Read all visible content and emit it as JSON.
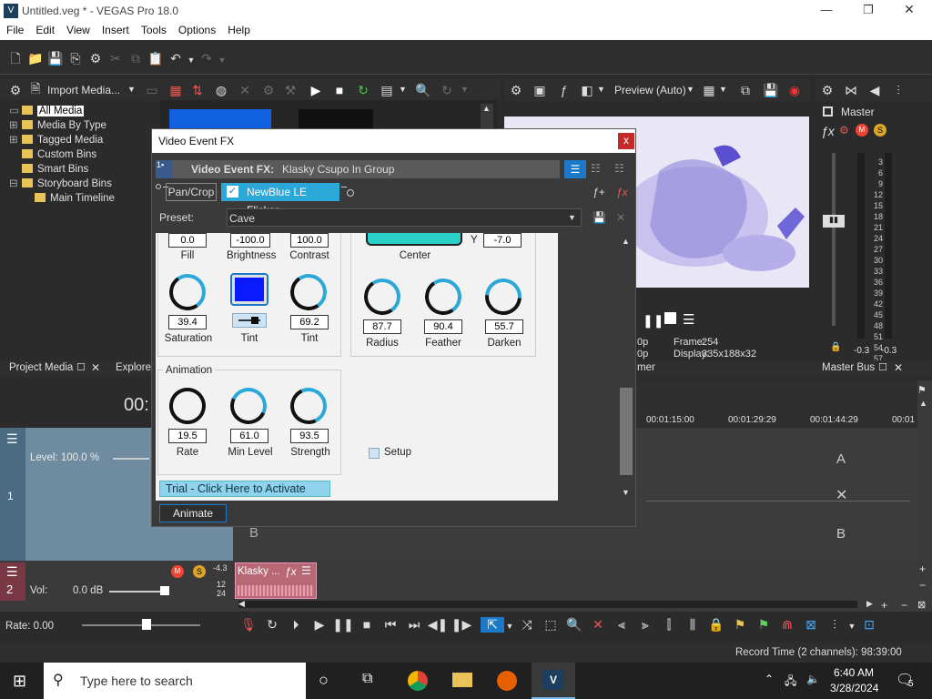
{
  "window": {
    "title": "Untitled.veg * - VEGAS Pro 18.0",
    "icon": "V",
    "minimize": "—",
    "restore": "❐",
    "close": "✕"
  },
  "menu": [
    "File",
    "Edit",
    "View",
    "Insert",
    "Tools",
    "Options",
    "Help"
  ],
  "media_toolbar": {
    "import_label": "Import Media..."
  },
  "tree": {
    "items": [
      "All Media",
      "Media By Type",
      "Tagged Media",
      "Custom Bins",
      "Smart Bins",
      "Storyboard Bins",
      "Main Timeline"
    ]
  },
  "preview": {
    "label": "Preview (Auto)",
    "frame_label": "Frame:",
    "frame_value": "254",
    "display_label": "Display:",
    "display_value": "335x188x32",
    "left_fragment_1": "0p",
    "left_fragment_2": "0p"
  },
  "master": {
    "label": "Master",
    "bus_label": "Master Bus",
    "close": "✕",
    "scale": [
      "3",
      "6",
      "9",
      "12",
      "15",
      "18",
      "21",
      "24",
      "27",
      "30",
      "33",
      "36",
      "39",
      "42",
      "45",
      "48",
      "51",
      "54",
      "57"
    ],
    "peak_left": "-0.3",
    "peak_right": "-0.3"
  },
  "tabs": {
    "project_media": "Project Media",
    "explorer": "Explorer",
    "mixer_fragment": "mer"
  },
  "timecode": "00:",
  "timeline": {
    "ruler": [
      "00:01:15:00",
      "00:01:29:29",
      "00:01:44:29",
      "00:01"
    ],
    "track1": {
      "level": "Level: 100.0 %",
      "number": "1"
    },
    "track2": {
      "number": "2",
      "vol_label": "Vol:",
      "vol_value": "0.0 dB",
      "meter_top": "-4.3",
      "meter_12": "12",
      "meter_24": "24"
    },
    "clip_label": "Klasky ...",
    "transition": {
      "a": "A",
      "b": "B",
      "x": "✕"
    },
    "b_left": "B",
    "rate": "Rate: 0.00"
  },
  "status": {
    "record_time": "Record Time (2 channels): 98:39:00"
  },
  "taskbar": {
    "search_placeholder": "Type here to search",
    "time": "6:40 AM",
    "date": "3/28/2024",
    "notif_count": "5"
  },
  "dialog": {
    "title": "Video Event FX",
    "close": "x",
    "header": "Video Event FX:",
    "header_target": "Klasky Csupo In Group",
    "chain": {
      "pan_crop": "Pan/Crop",
      "effect": "NewBlue LE Flicker"
    },
    "preset_label": "Preset:",
    "preset_value": "Cave",
    "top_values": [
      "0.0",
      "-100.0",
      "100.0"
    ],
    "top_labels": [
      "Fill",
      "Brightness",
      "Contrast"
    ],
    "center_label": "Center",
    "y_label": "Y",
    "y_value": "-7.0",
    "row2_values": [
      "39.4",
      "69.2"
    ],
    "row2_labels": [
      "Saturation",
      "Tint",
      "Tint"
    ],
    "right_values": [
      "87.7",
      "90.4",
      "55.7"
    ],
    "right_labels": [
      "Radius",
      "Feather",
      "Darken"
    ],
    "animation_title": "Animation",
    "anim_values": [
      "19.5",
      "61.0",
      "93.5"
    ],
    "anim_labels": [
      "Rate",
      "Min Level",
      "Strength"
    ],
    "setup_label": "Setup",
    "trial_label": "Trial - Click Here to Activate",
    "animate_button": "Animate",
    "tint_color": "#0a1aff"
  }
}
